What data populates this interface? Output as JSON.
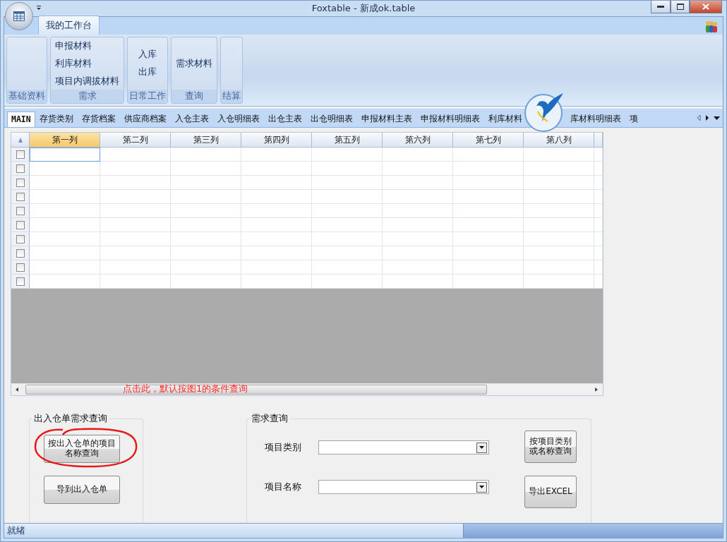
{
  "window": {
    "title": "Foxtable - 新成ok.table"
  },
  "ribbon": {
    "tabs": [
      {
        "label": "我的工作台",
        "selected": true
      }
    ],
    "groups": [
      {
        "label": "基础资料"
      },
      {
        "label": "需求",
        "items": [
          "申报材料",
          "利库材料",
          "项目内调拔材料"
        ]
      },
      {
        "label": "日常工作",
        "items": [
          "入库",
          "出库"
        ]
      },
      {
        "label": "查询",
        "items": [
          "需求材料"
        ]
      },
      {
        "label": "结算"
      }
    ]
  },
  "sheet_tabs": [
    {
      "label": "MAIN",
      "selected": true
    },
    {
      "label": "存货类别",
      "selected": false
    },
    {
      "label": "存货档案",
      "selected": false
    },
    {
      "label": "供应商档案",
      "selected": false
    },
    {
      "label": "入仓主表",
      "selected": false
    },
    {
      "label": "入仓明细表",
      "selected": false
    },
    {
      "label": "出仓主表",
      "selected": false
    },
    {
      "label": "出仓明细表",
      "selected": false
    },
    {
      "label": "申报材料主表",
      "selected": false
    },
    {
      "label": "申报材料明细表",
      "selected": false
    },
    {
      "label": "利库材料",
      "selected": false
    },
    {
      "kind": "logo"
    },
    {
      "label": "库材料明细表",
      "selected": false
    },
    {
      "label": "项",
      "selected": false
    }
  ],
  "grid": {
    "columns": [
      {
        "label": "第一列",
        "selected": true
      },
      {
        "label": "第二列",
        "selected": false
      },
      {
        "label": "第三列",
        "selected": false
      },
      {
        "label": "第四列",
        "selected": false
      },
      {
        "label": "第五列",
        "selected": false
      },
      {
        "label": "第六列",
        "selected": false
      },
      {
        "label": "第七列",
        "selected": false
      },
      {
        "label": "第八列",
        "selected": false
      }
    ],
    "rows": [
      {
        "checked": false,
        "selected": true
      },
      {
        "checked": false,
        "selected": false
      },
      {
        "checked": false,
        "selected": false
      },
      {
        "checked": false,
        "selected": false
      },
      {
        "checked": false,
        "selected": false
      },
      {
        "checked": false,
        "selected": false
      },
      {
        "checked": false,
        "selected": false
      },
      {
        "checked": false,
        "selected": false
      },
      {
        "checked": false,
        "selected": false
      },
      {
        "checked": false,
        "selected": false
      }
    ]
  },
  "annotation": {
    "text": "点击此，默认按图1的条件查询"
  },
  "left_group": {
    "title": "出入仓单需求查询",
    "buttons": [
      {
        "label": "按出入仓单的项目名称查询",
        "circled": true
      },
      {
        "label": "导到出入仓单",
        "circled": false
      }
    ]
  },
  "right_group": {
    "title": "需求查询",
    "fields": [
      {
        "label": "项目类别"
      },
      {
        "label": "项目名称"
      }
    ],
    "buttons": [
      "按项目类别或名称查询",
      "导出EXCEL"
    ]
  },
  "status_bar": {
    "text": "就绪"
  }
}
